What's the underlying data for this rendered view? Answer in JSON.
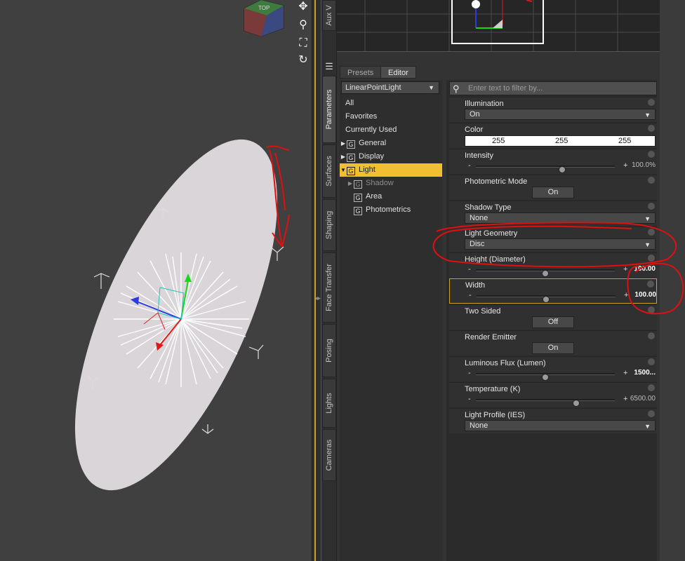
{
  "viewport": {
    "cube_label": "TOP"
  },
  "side_tabs": [
    "Aux V",
    "Parameters",
    "Surfaces",
    "Shaping",
    "Face Transfer",
    "Posing",
    "Lights",
    "Cameras"
  ],
  "pane": {
    "tabs": [
      "Presets",
      "Editor"
    ],
    "active_tab": "Editor",
    "node_selector": "LinearPointLight",
    "filter_placeholder": "Enter text to filter by...",
    "tree": [
      "All",
      "Favorites",
      "Currently Used",
      "General",
      "Display",
      "Light",
      "Shadow",
      "Area",
      "Photometrics"
    ],
    "group_icon_letter": "G"
  },
  "properties": {
    "illumination": {
      "label": "Illumination",
      "value": "On"
    },
    "color": {
      "label": "Color",
      "r": "255",
      "g": "255",
      "b": "255"
    },
    "intensity": {
      "label": "Intensity",
      "value": "100.0%",
      "position": 0.62
    },
    "photometric_mode": {
      "label": "Photometric Mode",
      "value": "On"
    },
    "shadow_type": {
      "label": "Shadow Type",
      "value": "None"
    },
    "light_geometry": {
      "label": "Light Geometry",
      "value": "Disc"
    },
    "height": {
      "label": "Height (Diameter)",
      "value": "100.00",
      "position": 0.5
    },
    "width": {
      "label": "Width",
      "value": "100.00",
      "position": 0.5
    },
    "two_sided": {
      "label": "Two Sided",
      "value": "Off"
    },
    "render_emitter": {
      "label": "Render Emitter",
      "value": "On"
    },
    "luminous_flux": {
      "label": "Luminous Flux (Lumen)",
      "value": "1500...",
      "position": 0.5
    },
    "temperature": {
      "label": "Temperature (K)",
      "value": "6500.00",
      "position": 0.72
    },
    "light_profile": {
      "label": "Light Profile (IES)",
      "value": "None"
    }
  }
}
